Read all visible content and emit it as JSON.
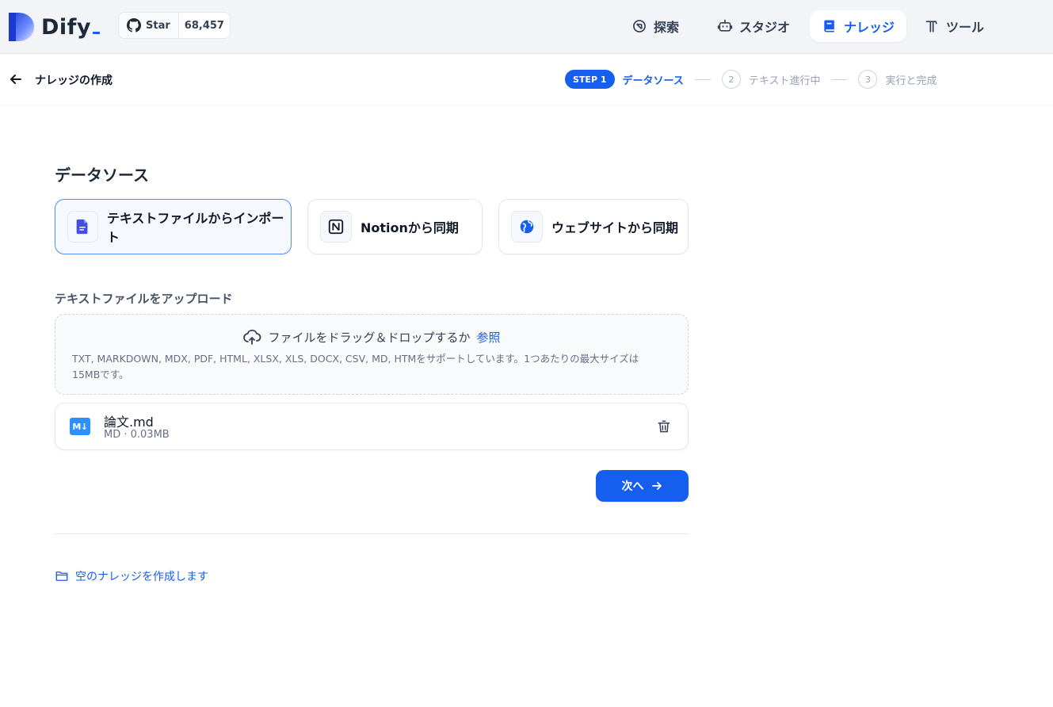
{
  "brand": {
    "name": "Dify",
    "accent": "#155eef"
  },
  "github": {
    "star_label": "Star",
    "star_count": "68,457"
  },
  "nav": [
    {
      "label": "探索",
      "icon": "compass-icon",
      "active": false
    },
    {
      "label": "スタジオ",
      "icon": "robot-icon",
      "active": false
    },
    {
      "label": "ナレッジ",
      "icon": "book-icon",
      "active": true
    },
    {
      "label": "ツール",
      "icon": "hammer-icon",
      "active": false
    }
  ],
  "subheader": {
    "title": "ナレッジの作成",
    "steps": {
      "step1_badge": "STEP 1",
      "step1_label": "データソース",
      "step2_num": "2",
      "step2_label": "テキスト進行中",
      "step3_num": "3",
      "step3_label": "実行と完成"
    }
  },
  "main": {
    "section_title": "データソース",
    "sources": [
      {
        "label": "テキストファイルからインポート",
        "icon": "file-text-icon",
        "active": true
      },
      {
        "label": "Notionから同期",
        "icon": "notion-icon",
        "active": false
      },
      {
        "label": "ウェブサイトから同期",
        "icon": "globe-icon",
        "active": false
      }
    ],
    "upload_title": "テキストファイルをアップロード",
    "dropzone": {
      "prompt": "ファイルをドラッグ＆ドロップするか",
      "browse": "参照",
      "hint": "TXT, MARKDOWN, MDX, PDF, HTML, XLSX, XLS, DOCX, CSV, MD, HTMをサポートしています。1つあたりの最大サイズは15MBです。"
    },
    "file": {
      "icon_text": "M↓",
      "name": "論文.md",
      "meta": "MD · 0.03MB"
    },
    "next_label": "次へ",
    "empty_link": "空のナレッジを作成します"
  }
}
